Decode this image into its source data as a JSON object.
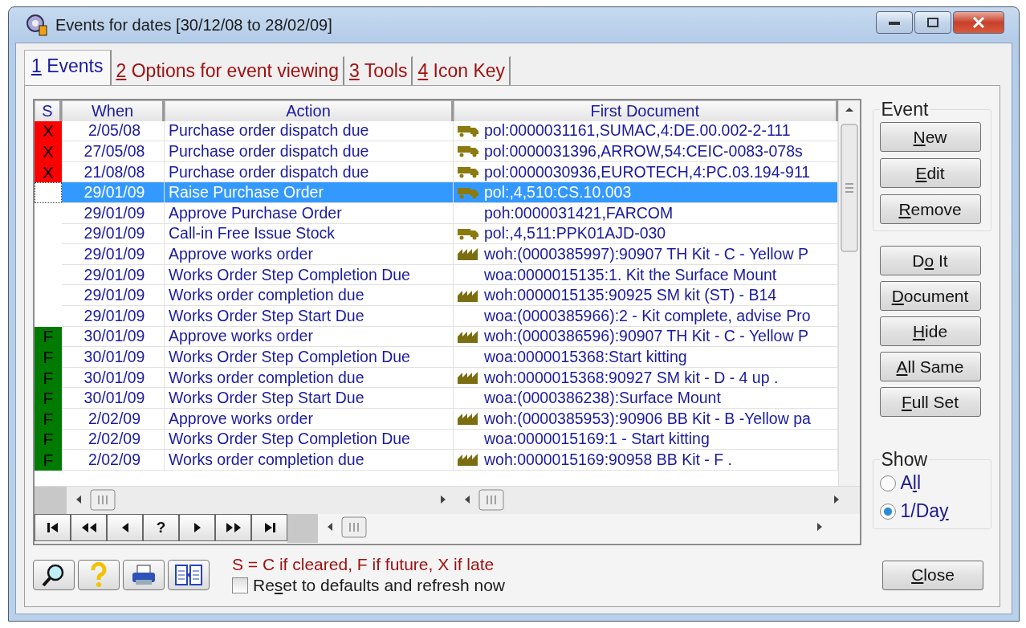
{
  "window": {
    "title": "Events for dates [30/12/08 to 28/02/09]"
  },
  "tabs": [
    {
      "key": "1",
      "label": " Events",
      "selected": true
    },
    {
      "key": "2",
      "label": " Options for event viewing",
      "selected": false
    },
    {
      "key": "3",
      "label": " Tools",
      "selected": false
    },
    {
      "key": "4",
      "label": " Icon Key",
      "selected": false
    }
  ],
  "table": {
    "columns": [
      "S",
      "When",
      "Action",
      "First Document"
    ],
    "rows": [
      {
        "status": {
          "label": "X",
          "color": "#ff0000"
        },
        "when": "2/05/08",
        "action": "Purchase order dispatch due",
        "kind": "truck",
        "document": "pol:0000031161,SUMAC,4:DE.00.002-2-111",
        "selected": false
      },
      {
        "status": {
          "label": "X",
          "color": "#ff0000"
        },
        "when": "27/05/08",
        "action": "Purchase order dispatch due",
        "kind": "truck",
        "document": "pol:0000031396,ARROW,54:CEIC-0083-078s",
        "selected": false
      },
      {
        "status": {
          "label": "X",
          "color": "#ff0000"
        },
        "when": "21/08/08",
        "action": "Purchase order dispatch due",
        "kind": "truck",
        "document": "pol:0000030936,EUROTECH,4:PC.03.194-911",
        "selected": false
      },
      {
        "when": "29/01/09",
        "action": "Raise Purchase Order",
        "kind": "truck",
        "document": "pol:,4,510:CS.10.003",
        "selected": true
      },
      {
        "when": "29/01/09",
        "action": "Approve Purchase Order",
        "kind": "plain",
        "document": "poh:0000031421,FARCOM",
        "selected": false
      },
      {
        "when": "29/01/09",
        "action": "Call-in Free Issue Stock",
        "kind": "truck",
        "document": "pol:,4,511:PPK01AJD-030",
        "selected": false
      },
      {
        "when": "29/01/09",
        "action": "Approve works order",
        "kind": "factory",
        "document": "woh:(0000385997):90907 TH Kit - C - Yellow P",
        "selected": false
      },
      {
        "when": "29/01/09",
        "action": "Works Order Step Completion Due",
        "kind": "plain",
        "document": "woa:0000015135:1. Kit the Surface Mount",
        "selected": false
      },
      {
        "when": "29/01/09",
        "action": "Works order completion due",
        "kind": "factory",
        "document": "woh:0000015135:90925 SM kit (ST) - B14",
        "selected": false
      },
      {
        "when": "29/01/09",
        "action": "Works Order Step Start Due",
        "kind": "plain",
        "document": "woa:(0000385966):2 - Kit complete, advise Pro",
        "selected": false
      },
      {
        "status": {
          "label": "F",
          "color": "#007a00"
        },
        "when": "30/01/09",
        "action": "Approve works order",
        "kind": "factory",
        "document": "woh:(0000386596):90907 TH Kit - C - Yellow P",
        "selected": false
      },
      {
        "status": {
          "label": "F",
          "color": "#007a00"
        },
        "when": "30/01/09",
        "action": "Works Order Step Completion Due",
        "kind": "plain",
        "document": "woa:0000015368:Start kitting",
        "selected": false
      },
      {
        "status": {
          "label": "F",
          "color": "#007a00"
        },
        "when": "30/01/09",
        "action": "Works order completion due",
        "kind": "factory",
        "document": "woh:0000015368:90927 SM kit - D - 4 up .",
        "selected": false
      },
      {
        "status": {
          "label": "F",
          "color": "#007a00"
        },
        "when": "30/01/09",
        "action": "Works Order Step Start Due",
        "kind": "plain",
        "document": "woa:(0000386238):Surface Mount",
        "selected": false
      },
      {
        "status": {
          "label": "F",
          "color": "#007a00"
        },
        "when": "2/02/09",
        "action": "Approve works order",
        "kind": "factory",
        "document": "woh:(0000385953):90906 BB Kit - B -Yellow pa",
        "selected": false
      },
      {
        "status": {
          "label": "F",
          "color": "#007a00"
        },
        "when": "2/02/09",
        "action": "Works Order Step Completion Due",
        "kind": "plain",
        "document": "woa:0000015169:1 - Start kitting",
        "selected": false
      },
      {
        "status": {
          "label": "F",
          "color": "#007a00"
        },
        "when": "2/02/09",
        "action": "Works order completion due",
        "kind": "factory",
        "document": "woh:0000015169:90958 BB Kit - F .",
        "selected": false
      }
    ]
  },
  "navigator": [
    {
      "kind": "first"
    },
    {
      "kind": "prev_page"
    },
    {
      "kind": "prev"
    },
    {
      "kind": "query",
      "label": "?"
    },
    {
      "kind": "next"
    },
    {
      "kind": "next_page"
    },
    {
      "kind": "last"
    }
  ],
  "event_group": {
    "title": "Event",
    "buttons": [
      {
        "key": "N",
        "after": "ew"
      },
      {
        "key": "E",
        "after": "dit"
      },
      {
        "key": "R",
        "after": "emove"
      }
    ]
  },
  "action_buttons": [
    {
      "before": "D",
      "key": "o",
      "after": " It"
    },
    {
      "key": "D",
      "after": "ocument"
    },
    {
      "key": "H",
      "after": "ide"
    },
    {
      "key": "A",
      "after": "ll Same"
    },
    {
      "key": "F",
      "after": "ull Set"
    }
  ],
  "show_group": {
    "title": "Show",
    "options": [
      {
        "parts": {
          "before": "A",
          "key": "l",
          "after": "l"
        },
        "selected": false
      },
      {
        "parts": {
          "before": "1/Da",
          "key": "y"
        },
        "selected": true
      }
    ]
  },
  "toolbar": [
    {
      "kind": "search"
    },
    {
      "kind": "help"
    },
    {
      "kind": "print"
    },
    {
      "kind": "columns"
    }
  ],
  "legend": "S = C if cleared, F if future, X if late",
  "reset": {
    "parts": {
      "before": "Re",
      "key": "s",
      "after": "et to defaults and refresh now"
    },
    "checked": false
  },
  "close_button": {
    "key": "C",
    "after": "lose"
  }
}
